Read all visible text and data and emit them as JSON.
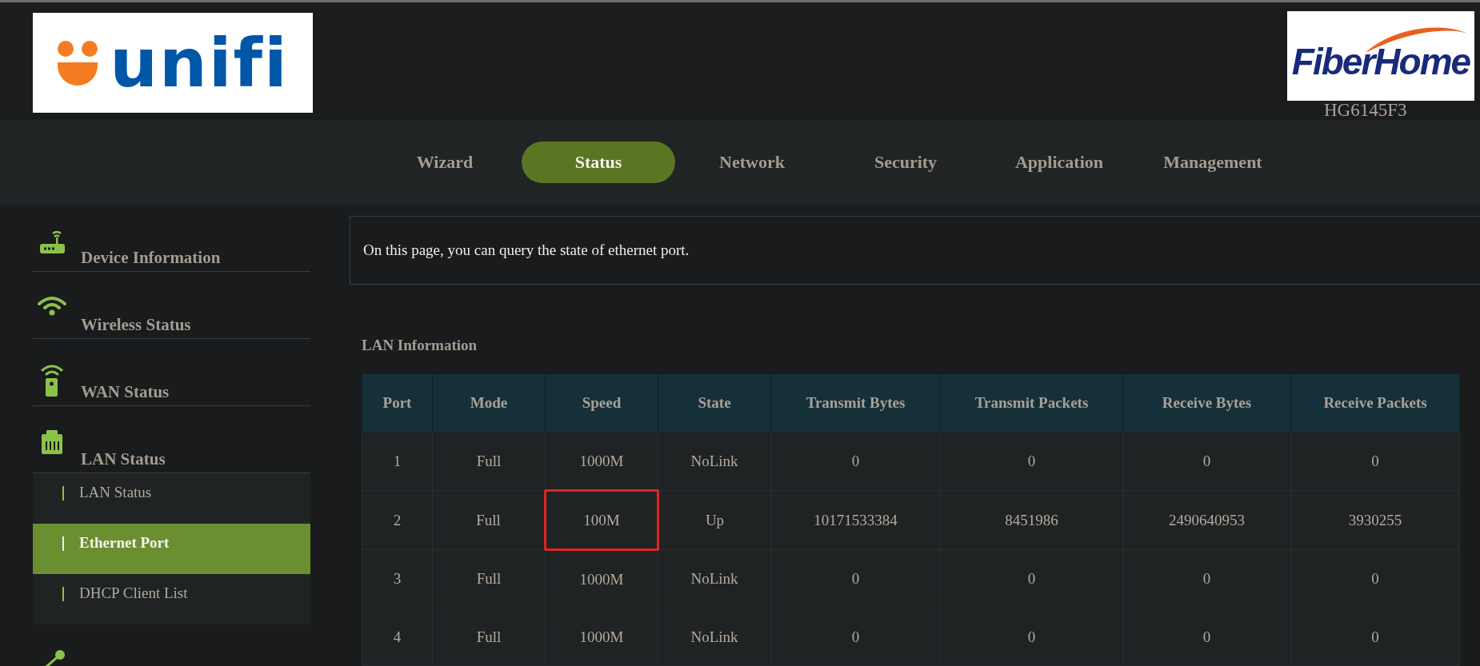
{
  "header": {
    "brand_logo": "unifi",
    "vendor_logo": "FiberHome",
    "model": "HG6145F3"
  },
  "tabs": [
    {
      "label": "Wizard",
      "selected": false
    },
    {
      "label": "Status",
      "selected": true
    },
    {
      "label": "Network",
      "selected": false
    },
    {
      "label": "Security",
      "selected": false
    },
    {
      "label": "Application",
      "selected": false
    },
    {
      "label": "Management",
      "selected": false
    }
  ],
  "sidebar": {
    "items": [
      {
        "kind": "device",
        "label": "Device Information"
      },
      {
        "kind": "wireless",
        "label": "Wireless Status"
      },
      {
        "kind": "wan",
        "label": "WAN Status"
      },
      {
        "kind": "lan",
        "label": "LAN Status",
        "children": [
          {
            "label": "LAN Status",
            "selected": false
          },
          {
            "label": "Ethernet Port",
            "selected": true
          },
          {
            "label": "DHCP Client List",
            "selected": false
          }
        ]
      },
      {
        "kind": "route"
      }
    ]
  },
  "notice": "On this page, you can query the state of ethernet port.",
  "section_title": "LAN Information",
  "table": {
    "columns": [
      "Port",
      "Mode",
      "Speed",
      "State",
      "Transmit Bytes",
      "Transmit Packets",
      "Receive Bytes",
      "Receive Packets"
    ],
    "rows": [
      {
        "cells": [
          {
            "text": "1",
            "highlighted": false
          },
          {
            "text": "Full",
            "highlighted": false
          },
          {
            "text": "1000M",
            "highlighted": false
          },
          {
            "text": "NoLink",
            "highlighted": false
          },
          {
            "text": "0",
            "highlighted": false
          },
          {
            "text": "0",
            "highlighted": false
          },
          {
            "text": "0",
            "highlighted": false
          },
          {
            "text": "0",
            "highlighted": false
          }
        ]
      },
      {
        "cells": [
          {
            "text": "2",
            "highlighted": false
          },
          {
            "text": "Full",
            "highlighted": false
          },
          {
            "text": "100M",
            "highlighted": true
          },
          {
            "text": "Up",
            "highlighted": false
          },
          {
            "text": "10171533384",
            "highlighted": false
          },
          {
            "text": "8451986",
            "highlighted": false
          },
          {
            "text": "2490640953",
            "highlighted": false
          },
          {
            "text": "3930255",
            "highlighted": false
          }
        ]
      },
      {
        "cells": [
          {
            "text": "3",
            "highlighted": false
          },
          {
            "text": "Full",
            "highlighted": false
          },
          {
            "text": "1000M",
            "highlighted": false
          },
          {
            "text": "NoLink",
            "highlighted": false
          },
          {
            "text": "0",
            "highlighted": false
          },
          {
            "text": "0",
            "highlighted": false
          },
          {
            "text": "0",
            "highlighted": false
          },
          {
            "text": "0",
            "highlighted": false
          }
        ]
      },
      {
        "cells": [
          {
            "text": "4",
            "highlighted": false
          },
          {
            "text": "Full",
            "highlighted": false
          },
          {
            "text": "1000M",
            "highlighted": false
          },
          {
            "text": "NoLink",
            "highlighted": false
          },
          {
            "text": "0",
            "highlighted": false
          },
          {
            "text": "0",
            "highlighted": false
          },
          {
            "text": "0",
            "highlighted": false
          },
          {
            "text": "0",
            "highlighted": false
          }
        ]
      }
    ]
  }
}
